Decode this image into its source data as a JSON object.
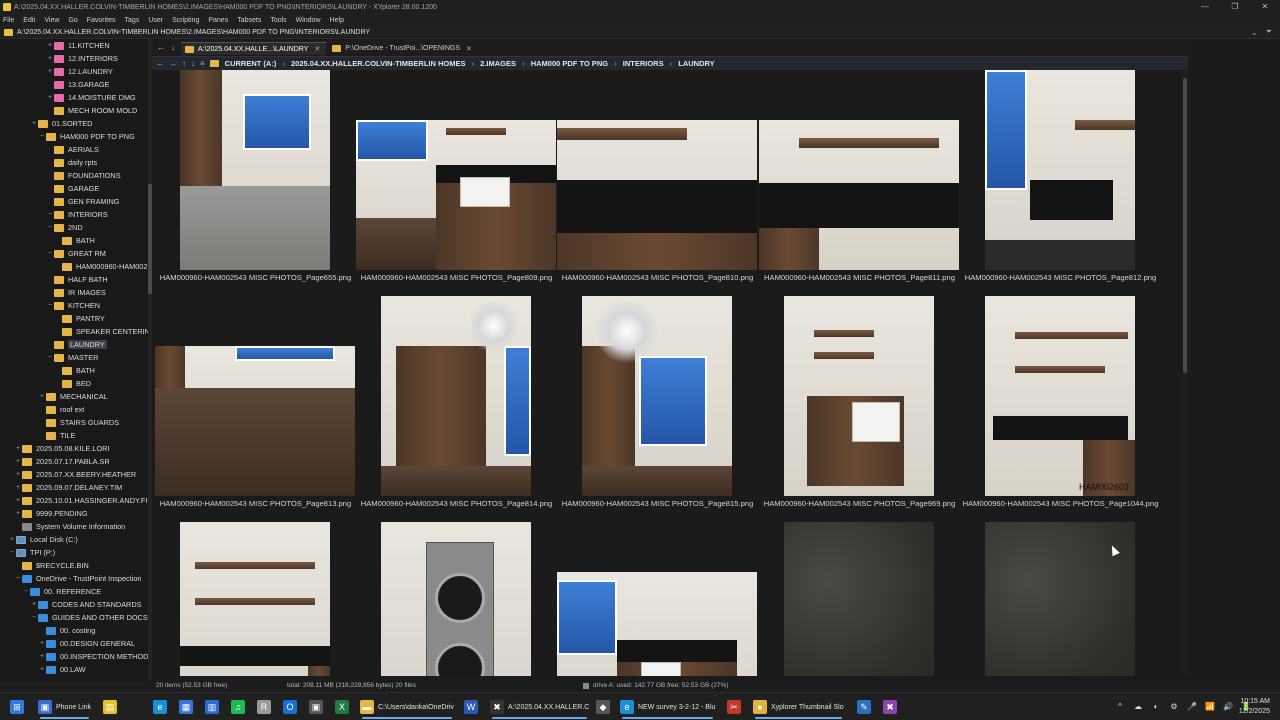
{
  "window": {
    "title": "A:\\2025.04.XX.HALLER.COLVIN-TIMBERLIN HOMES\\2.IMAGES\\HAM000 PDF TO PNG\\INTERIORS\\LAUNDRY - XYplorer 28.00.1200",
    "minimize": "—",
    "maximize": "❐",
    "close": "✕"
  },
  "menu": [
    "File",
    "Edit",
    "View",
    "Go",
    "Favorites",
    "Tags",
    "User",
    "Scripting",
    "Panes",
    "Tabsets",
    "Tools",
    "Window",
    "Help"
  ],
  "address": {
    "path": "A:\\2025.04.XX.HALLER.COLVIN-TIMBERLIN HOMES\\2.IMAGES\\HAM000 PDF TO PNG\\INTERIORS\\LAUNDRY",
    "chevron": "⌄",
    "filter": "⏷"
  },
  "tree": [
    {
      "label": "11.KITCHEN",
      "color": "pink",
      "exp": "+",
      "selected": false
    },
    {
      "label": "12.INTERIORS",
      "color": "pink",
      "exp": "+",
      "selected": false
    },
    {
      "label": "12.LAUNDRY",
      "color": "pink",
      "exp": "+",
      "selected": false
    },
    {
      "label": "13.GARAGE",
      "color": "pink",
      "exp": "",
      "selected": false
    },
    {
      "label": "14.MOISTURE DMG",
      "color": "pink",
      "exp": "+",
      "selected": false
    },
    {
      "label": "MECH ROOM MOLD",
      "color": "yellow",
      "exp": "",
      "selected": false
    },
    {
      "label": "01.SORTED",
      "color": "yellow",
      "exp": "+",
      "selected": false
    },
    {
      "label": "HAM000 PDF TO PNG",
      "color": "yellow",
      "exp": "−",
      "selected": false
    },
    {
      "label": "AERIALS",
      "color": "yellow",
      "exp": "",
      "selected": false
    },
    {
      "label": "daily rpts",
      "color": "yellow",
      "exp": "",
      "selected": false
    },
    {
      "label": "FOUNDATIONS",
      "color": "yellow",
      "exp": "",
      "selected": false
    },
    {
      "label": "GARAGE",
      "color": "yellow",
      "exp": "",
      "selected": false
    },
    {
      "label": "GEN FRAMING",
      "color": "yellow",
      "exp": "",
      "selected": false
    },
    {
      "label": "INTERIORS",
      "color": "yellow",
      "exp": "−",
      "selected": false
    },
    {
      "label": "2ND",
      "color": "yellow",
      "exp": "−",
      "selected": false
    },
    {
      "label": "BATH",
      "color": "yellow",
      "exp": "",
      "selected": false
    },
    {
      "label": "GREAT RM",
      "color": "yellow",
      "exp": "−",
      "selected": false
    },
    {
      "label": "HAM000960-HAM002",
      "color": "yellow",
      "exp": "",
      "selected": false
    },
    {
      "label": "HALF BATH",
      "color": "yellow",
      "exp": "",
      "selected": false
    },
    {
      "label": "IR IMAGES",
      "color": "yellow",
      "exp": "",
      "selected": false
    },
    {
      "label": "KITCHEN",
      "color": "yellow",
      "exp": "−",
      "selected": false
    },
    {
      "label": "PANTRY",
      "color": "yellow",
      "exp": "",
      "selected": false
    },
    {
      "label": "SPEAKER CENTERING",
      "color": "yellow",
      "exp": "",
      "selected": false
    },
    {
      "label": "LAUNDRY",
      "color": "yellow",
      "exp": "",
      "selected": true
    },
    {
      "label": "MASTER",
      "color": "yellow",
      "exp": "−",
      "selected": false
    },
    {
      "label": "BATH",
      "color": "yellow",
      "exp": "",
      "selected": false
    },
    {
      "label": "BED",
      "color": "yellow",
      "exp": "",
      "selected": false
    },
    {
      "label": "MECHANICAL",
      "color": "yellow",
      "exp": "+",
      "selected": false
    },
    {
      "label": "roof ext",
      "color": "yellow",
      "exp": "",
      "selected": false
    },
    {
      "label": "STAIRS GUARDS",
      "color": "yellow",
      "exp": "",
      "selected": false
    },
    {
      "label": "TILE",
      "color": "yellow",
      "exp": "",
      "selected": false
    },
    {
      "label": "2025.05.08.KILE.LORI",
      "color": "yellow",
      "exp": "+",
      "selected": false
    },
    {
      "label": "2025.07.17.PABLA.SR",
      "color": "yellow",
      "exp": "+",
      "selected": false
    },
    {
      "label": "2025.07.XX.BEERY.HEATHER",
      "color": "yellow",
      "exp": "+",
      "selected": false
    },
    {
      "label": "2025.09.07.DELANEY.TIM",
      "color": "yellow",
      "exp": "+",
      "selected": false
    },
    {
      "label": "2025.10.01.HASSINGER.ANDY.FIN",
      "color": "yellow",
      "exp": "+",
      "selected": false
    },
    {
      "label": "9999.PENDING",
      "color": "yellow",
      "exp": "+",
      "selected": false
    },
    {
      "label": "System Volume Information",
      "color": "gray",
      "exp": "",
      "selected": false
    },
    {
      "label": "Local Disk (C:)",
      "color": "drive",
      "exp": "+",
      "selected": false
    },
    {
      "label": "TPI (P:)",
      "color": "drive",
      "exp": "−",
      "selected": false
    },
    {
      "label": "$RECYCLE.BIN",
      "color": "yellow",
      "exp": "",
      "selected": false
    },
    {
      "label": "OneDrive - TrustPoint Inspection",
      "color": "blue",
      "exp": "−",
      "selected": false
    },
    {
      "label": "00. REFERENCE",
      "color": "blue",
      "exp": "−",
      "selected": false
    },
    {
      "label": "CODES AND STANDARDS",
      "color": "blue",
      "exp": "+",
      "selected": false
    },
    {
      "label": "GUIDES AND OTHER DOCS",
      "color": "blue",
      "exp": "−",
      "selected": false
    },
    {
      "label": "00. costing",
      "color": "blue",
      "exp": "",
      "selected": false
    },
    {
      "label": "00.DESIGN GENERAL",
      "color": "blue",
      "exp": "+",
      "selected": false
    },
    {
      "label": "00.INSPECTION METHODS",
      "color": "blue",
      "exp": "+",
      "selected": false
    },
    {
      "label": "00.LAW",
      "color": "blue",
      "exp": "+",
      "selected": false
    }
  ],
  "tabs": {
    "nav_back": "←",
    "nav_fwd": "↓",
    "items": [
      {
        "label": "A:\\2025.04.XX.HALLE...\\LAUNDRY",
        "close": "✕"
      },
      {
        "label": "P:\\OneDrive - TrustPoi...\\OPENINGS",
        "close": "✕"
      }
    ]
  },
  "breadcrumb": {
    "back": "←",
    "forward": "→",
    "up": "↑",
    "down": "↓",
    "menu": "≡",
    "items": [
      "CURRENT (A:)",
      "2025.04.XX.HALLER.COLVIN-TIMBERLIN HOMES",
      "2.IMAGES",
      "HAM000 PDF TO PNG",
      "INTERIORS",
      "LAUNDRY"
    ],
    "separator": "›"
  },
  "thumbnails": [
    {
      "caption": "HAM000960-HAM002543 MISC PHOTOS_Page655.png",
      "kind": "room-window",
      "orient": "portrait"
    },
    {
      "caption": "HAM000960-HAM002543 MISC PHOTOS_Page809.png",
      "kind": "sink-window",
      "orient": "landscape"
    },
    {
      "caption": "HAM000960-HAM002543 MISC PHOTOS_Page810.png",
      "kind": "counter",
      "orient": "landscape"
    },
    {
      "caption": "HAM000960-HAM002543 MISC PHOTOS_Page811.png",
      "kind": "counter-shelf",
      "orient": "landscape"
    },
    {
      "caption": "HAM000960-HAM002543 MISC PHOTOS_Page812.png",
      "kind": "desk-window",
      "orient": "portrait"
    },
    {
      "caption": "HAM000960-HAM002543 MISC PHOTOS_Page813.png",
      "kind": "floor-window",
      "orient": "landscape"
    },
    {
      "caption": "HAM000960-HAM002543 MISC PHOTOS_Page814.png",
      "kind": "cabinets-chandelier",
      "orient": "portrait"
    },
    {
      "caption": "HAM000960-HAM002543 MISC PHOTOS_Page815.png",
      "kind": "cabinets-window",
      "orient": "portrait"
    },
    {
      "caption": "HAM000960-HAM002543 MISC PHOTOS_Page969.png",
      "kind": "sink-shelves",
      "orient": "portrait"
    },
    {
      "caption": "HAM000960-HAM002543 MISC PHOTOS_Page1044.png",
      "kind": "desk-shelves",
      "orient": "portrait",
      "overlay": "HAM002603"
    },
    {
      "caption": "",
      "kind": "shelves-desk",
      "orient": "portrait"
    },
    {
      "caption": "",
      "kind": "washer",
      "orient": "portrait"
    },
    {
      "caption": "",
      "kind": "sink-small",
      "orient": "landscape"
    },
    {
      "caption": "",
      "kind": "granite",
      "orient": "portrait"
    },
    {
      "caption": "",
      "kind": "granite",
      "orient": "portrait"
    }
  ],
  "status": {
    "items": "20 items (52.53 GB free)",
    "total": "total: 208.11 MB (218,228,956 bytes)  20 files",
    "drive": "drive A:  used: 142.77 GB   free: 52.53 GB (27%)"
  },
  "taskbar": {
    "items": [
      {
        "name": "start",
        "label": "",
        "icon": "⊞",
        "color": "#2f7be0"
      },
      {
        "name": "phone-link",
        "label": "Phone Link",
        "icon": "▣",
        "color": "#3a6fd1"
      },
      {
        "name": "sticky",
        "label": "",
        "icon": "▤",
        "color": "#e4c02c"
      },
      {
        "name": "edge",
        "label": "",
        "icon": "e",
        "color": "#1b8fd1"
      },
      {
        "name": "store",
        "label": "",
        "icon": "▦",
        "color": "#3a73d8"
      },
      {
        "name": "notes",
        "label": "",
        "icon": "▥",
        "color": "#2b6bd4"
      },
      {
        "name": "spotify",
        "label": "",
        "icon": "♫",
        "color": "#1db954"
      },
      {
        "name": "r-app",
        "label": "",
        "icon": "R",
        "color": "#9a9a9a"
      },
      {
        "name": "outlook",
        "label": "",
        "icon": "O",
        "color": "#1b6fd0"
      },
      {
        "name": "app-box",
        "label": "",
        "icon": "▣",
        "color": "#555"
      },
      {
        "name": "excel",
        "label": "",
        "icon": "X",
        "color": "#1f7a43"
      },
      {
        "name": "explorer",
        "label": "C:\\Users\\danka\\OneDriv",
        "icon": "▬",
        "color": "#e4b548"
      },
      {
        "name": "word",
        "label": "",
        "icon": "W",
        "color": "#2a5aaf"
      },
      {
        "name": "xyplorer",
        "label": "A:\\2025.04.XX.HALLER.C",
        "icon": "✖",
        "color": "#333"
      },
      {
        "name": "vpn",
        "label": "",
        "icon": "◆",
        "color": "#555"
      },
      {
        "name": "survey",
        "label": "NEW survey 3-2-12 - Blu",
        "icon": "e",
        "color": "#1b8fd1"
      },
      {
        "name": "tool",
        "label": "",
        "icon": "✂",
        "color": "#c0392b"
      },
      {
        "name": "chrome",
        "label": "Xyplorer Thumbnail Slo",
        "icon": "●",
        "color": "#e2b23c"
      },
      {
        "name": "ps",
        "label": "",
        "icon": "✎",
        "color": "#2c6fc0"
      },
      {
        "name": "xy2",
        "label": "",
        "icon": "✖",
        "color": "#8e44ad"
      }
    ],
    "tray_icons": [
      "^",
      "☁",
      "◐",
      "⚙",
      "🎤",
      "📶",
      "🔊",
      "🔋"
    ],
    "time": "10:15 AM",
    "date": "12/2/2025"
  },
  "colors": {
    "accent": "#6aa9e8",
    "background": "#1b1b1b",
    "folder": "#e4b548"
  }
}
